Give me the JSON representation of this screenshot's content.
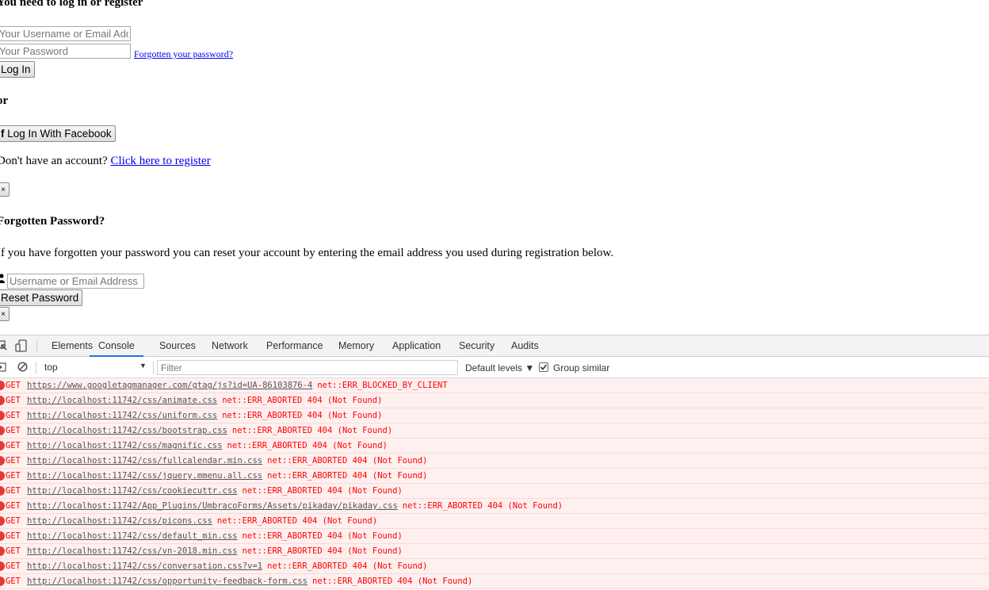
{
  "login": {
    "heading": "You need to log in or register",
    "username_placeholder": "Your Username or Email Address",
    "password_placeholder": "Your Password",
    "forgot_link": "Forgotten your password?",
    "login_button": "Log In",
    "or_text": "or",
    "facebook_button": "Log In With Facebook",
    "no_account_text": "Don't have an account?",
    "register_link": "Click here to register",
    "close_label": "×"
  },
  "forgot": {
    "heading": "Forgotten Password?",
    "description": "If you have forgotten your password you can reset your account by entering the email address you used during registration below.",
    "input_placeholder": "Username or Email Address",
    "reset_button": "Reset Password",
    "close_label": "×"
  },
  "devtools": {
    "tabs": [
      "Elements",
      "Console",
      "Sources",
      "Network",
      "Performance",
      "Memory",
      "Application",
      "Security",
      "Audits"
    ],
    "active_tab": "Console",
    "context": "top",
    "filter_placeholder": "Filter",
    "levels_label": "Default levels ▼",
    "group_similar_label": "Group similar",
    "group_similar_checked": true,
    "console_rows": [
      {
        "method": "GET",
        "url": "https://www.googletagmanager.com/gtag/js?id=UA-86103876-4",
        "message": "net::ERR_BLOCKED_BY_CLIENT"
      },
      {
        "method": "GET",
        "url": "http://localhost:11742/css/animate.css",
        "message": "net::ERR_ABORTED 404 (Not Found)"
      },
      {
        "method": "GET",
        "url": "http://localhost:11742/css/uniform.css",
        "message": "net::ERR_ABORTED 404 (Not Found)"
      },
      {
        "method": "GET",
        "url": "http://localhost:11742/css/bootstrap.css",
        "message": "net::ERR_ABORTED 404 (Not Found)"
      },
      {
        "method": "GET",
        "url": "http://localhost:11742/css/magnific.css",
        "message": "net::ERR_ABORTED 404 (Not Found)"
      },
      {
        "method": "GET",
        "url": "http://localhost:11742/css/fullcalendar.min.css",
        "message": "net::ERR_ABORTED 404 (Not Found)"
      },
      {
        "method": "GET",
        "url": "http://localhost:11742/css/jquery.mmenu.all.css",
        "message": "net::ERR_ABORTED 404 (Not Found)"
      },
      {
        "method": "GET",
        "url": "http://localhost:11742/css/cookiecuttr.css",
        "message": "net::ERR_ABORTED 404 (Not Found)"
      },
      {
        "method": "GET",
        "url": "http://localhost:11742/App_Plugins/UmbracoForms/Assets/pikaday/pikaday.css",
        "message": "net::ERR_ABORTED 404 (Not Found)"
      },
      {
        "method": "GET",
        "url": "http://localhost:11742/css/picons.css",
        "message": "net::ERR_ABORTED 404 (Not Found)"
      },
      {
        "method": "GET",
        "url": "http://localhost:11742/css/default_min.css",
        "message": "net::ERR_ABORTED 404 (Not Found)"
      },
      {
        "method": "GET",
        "url": "http://localhost:11742/css/vn-2018.min.css",
        "message": "net::ERR_ABORTED 404 (Not Found)"
      },
      {
        "method": "GET",
        "url": "http://localhost:11742/css/conversation.css?v=1",
        "message": "net::ERR_ABORTED 404 (Not Found)"
      },
      {
        "method": "GET",
        "url": "http://localhost:11742/css/opportunity-feedback-form.css",
        "message": "net::ERR_ABORTED 404 (Not Found)"
      }
    ]
  }
}
